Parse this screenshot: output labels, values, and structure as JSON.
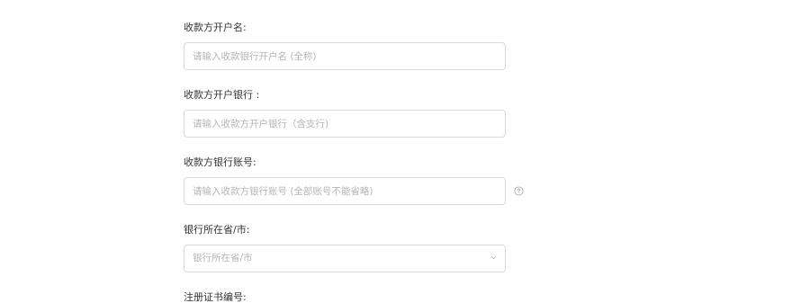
{
  "form": {
    "account_name": {
      "label": "收款方开户名:",
      "placeholder": "请输入收款银行开户名 (全称)",
      "value": ""
    },
    "bank_name": {
      "label": "收款方开户银行 :",
      "placeholder": "请输入收款方开户银行（含支行)",
      "value": ""
    },
    "account_number": {
      "label": "收款方银行账号:",
      "placeholder": "请输入收款方银行账号 (全部账号不能省略)",
      "value": ""
    },
    "bank_region": {
      "label": "银行所在省/市:",
      "selected": "银行所在省/市"
    },
    "registration_number": {
      "label": "注册证书编号:"
    }
  },
  "icons": {
    "help": "question-circle-icon",
    "select": "chevron-down-icon"
  },
  "colors": {
    "border": "#d9d9d9",
    "placeholder": "#b5b5b5",
    "label": "#333333",
    "icon": "#b0b0b0"
  }
}
